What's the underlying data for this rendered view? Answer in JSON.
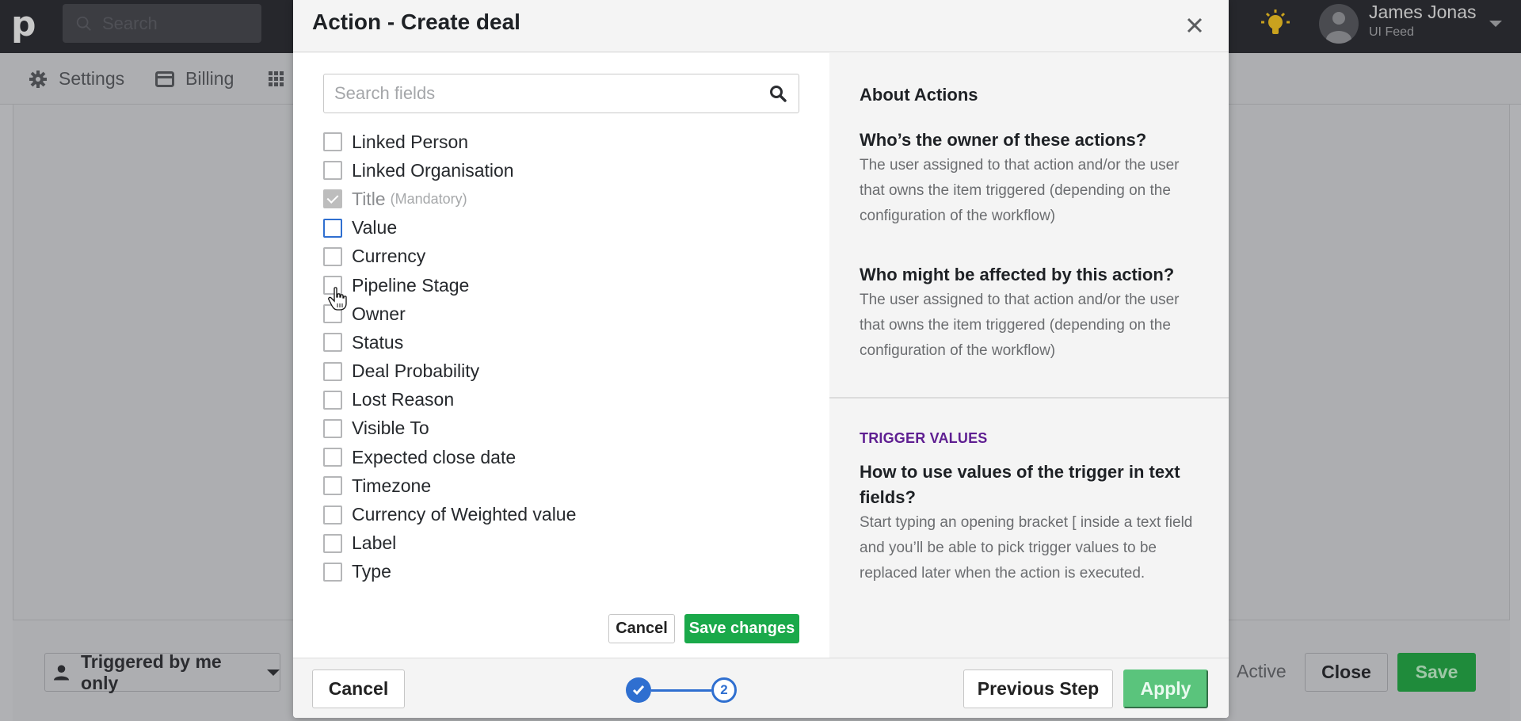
{
  "app": {
    "logo_text": "p",
    "global_search_placeholder": "Search",
    "user": {
      "name": "James Jonas",
      "company": "UI Feed"
    },
    "subnav": [
      {
        "label": "Settings",
        "icon": "gear-icon"
      },
      {
        "label": "Billing",
        "icon": "credit-card-icon"
      },
      {
        "label": "",
        "icon": "apps-grid-icon"
      }
    ],
    "footer": {
      "trigger_filter": "Triggered by me only",
      "status_label": "Active",
      "close_label": "Close",
      "save_label": "Save"
    }
  },
  "modal": {
    "title": "Action - Create deal",
    "search_placeholder": "Search fields",
    "search_value": "",
    "fields": [
      {
        "label": "Linked Person",
        "checked": false
      },
      {
        "label": "Linked Organisation",
        "checked": false
      },
      {
        "label": "Title",
        "note": "(Mandatory)",
        "checked": true,
        "disabled": true
      },
      {
        "label": "Value",
        "checked": false,
        "focused": true
      },
      {
        "label": "Currency",
        "checked": false
      },
      {
        "label": "Pipeline Stage",
        "checked": false
      },
      {
        "label": "Owner",
        "checked": false
      },
      {
        "label": "Status",
        "checked": false
      },
      {
        "label": "Deal Probability",
        "checked": false
      },
      {
        "label": "Lost Reason",
        "checked": false
      },
      {
        "label": "Visible To",
        "checked": false
      },
      {
        "label": "Expected close date",
        "checked": false
      },
      {
        "label": "Timezone",
        "checked": false
      },
      {
        "label": "Currency of Weighted value",
        "checked": false
      },
      {
        "label": "Label",
        "checked": false
      },
      {
        "label": "Type",
        "checked": false
      }
    ],
    "inner_cancel_label": "Cancel",
    "save_changes_label": "Save changes",
    "help": {
      "heading": "About Actions",
      "q1": "Who’s the owner of these actions?",
      "a1": "The user assigned to that action and/or the user that owns the item triggered (depending on the configuration of the workflow)",
      "q2": "Who might be affected by this action?",
      "a2": "The user assigned to that action and/or the user that owns the item triggered (depending on the configuration of the workflow)",
      "kicker": "TRIGGER VALUES",
      "q3": "How to use values of the trigger in text fields?",
      "a3": "Start typing an opening bracket [ inside a text field and you’ll be able to pick trigger values to be replaced later when the action is executed."
    },
    "footer": {
      "cancel_label": "Cancel",
      "steps": {
        "completed": 1,
        "current": 2,
        "current_label": "2",
        "total": 2
      },
      "previous_label": "Previous Step",
      "apply_label": "Apply"
    }
  },
  "colors": {
    "accent_blue": "#2f6fd0",
    "primary_green": "#1aa94a",
    "apply_green_disabled": "#5ac47c",
    "kicker_purple": "#5e1e91",
    "bulb_yellow": "#c9a21e"
  }
}
